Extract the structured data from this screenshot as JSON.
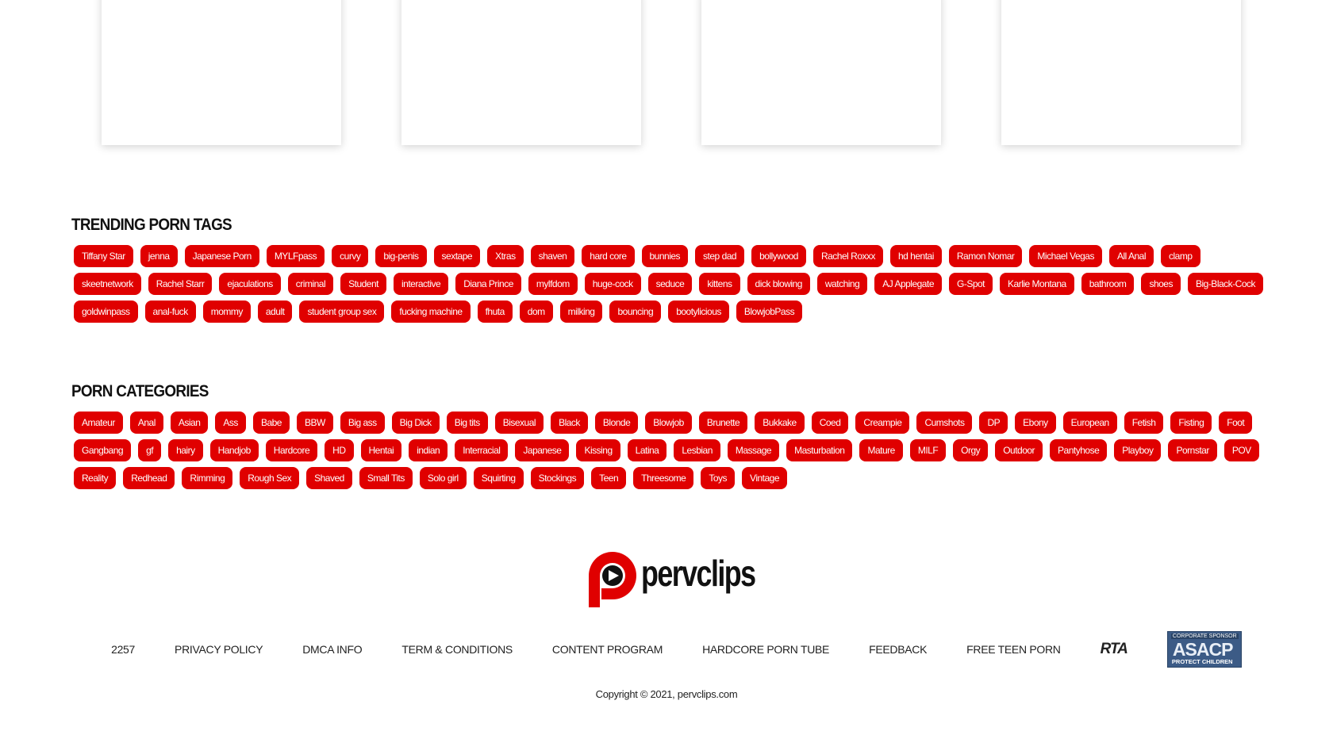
{
  "trending": {
    "heading": "TRENDING PORN TAGS",
    "tags": [
      "Tiffany Star",
      "jenna",
      "Japanese Porn",
      "MYLFpass",
      "curvy",
      "big-penis",
      "sextape",
      "Xtras",
      "shaven",
      "hard core",
      "bunnies",
      "step dad",
      "bollywood",
      "Rachel Roxxx",
      "hd hentai",
      "Ramon Nomar",
      "Michael Vegas",
      "All Anal",
      "clamp",
      "skeetnetwork",
      "Rachel Starr",
      "ejaculations",
      "criminal",
      "Student",
      "interactive",
      "Diana Prince",
      "mylfdom",
      "huge-cock",
      "seduce",
      "kittens",
      "dick blowing",
      "watching",
      "AJ Applegate",
      "G-Spot",
      "Karlie Montana",
      "bathroom",
      "shoes",
      "Big-Black-Cock",
      "goldwinpass",
      "anal-fuck",
      "mommy",
      "adult",
      "student group sex",
      "fucking machine",
      "fhuta",
      "dom",
      "milking",
      "bouncing",
      "bootylicious",
      "BlowjobPass"
    ]
  },
  "categories": {
    "heading": "PORN CATEGORIES",
    "tags": [
      "Amateur",
      "Anal",
      "Asian",
      "Ass",
      "Babe",
      "BBW",
      "Big ass",
      "Big Dick",
      "Big tits",
      "Bisexual",
      "Black",
      "Blonde",
      "Blowjob",
      "Brunette",
      "Bukkake",
      "Coed",
      "Creampie",
      "Cumshots",
      "DP",
      "Ebony",
      "European",
      "Fetish",
      "Fisting",
      "Foot",
      "Gangbang",
      "gf",
      "hairy",
      "Handjob",
      "Hardcore",
      "HD",
      "Hentai",
      "indian",
      "Interracial",
      "Japanese",
      "Kissing",
      "Latina",
      "Lesbian",
      "Massage",
      "Masturbation",
      "Mature",
      "MILF",
      "Orgy",
      "Outdoor",
      "Pantyhose",
      "Playboy",
      "Pornstar",
      "POV",
      "Reality",
      "Redhead",
      "Rimming",
      "Rough Sex",
      "Shaved",
      "Small Tits",
      "Solo girl",
      "Squirting",
      "Stockings",
      "Teen",
      "Threesome",
      "Toys",
      "Vintage"
    ]
  },
  "logo": {
    "text": "pervclips",
    "accent": "#e00000"
  },
  "footer": {
    "links": [
      "2257",
      "PRIVACY POLICY",
      "DMCA INFO",
      "TERM & CONDITIONS",
      "CONTENT PROGRAM",
      "HARDCORE PORN TUBE",
      "FEEDBACK",
      "FREE TEEN PORN"
    ],
    "rta": "RTA",
    "asacp_top": "CORPORATE SPONSOR",
    "asacp_mid": "ASACP",
    "asacp_bot": "PROTECT CHILDREN",
    "copyright": "Copyright © 2021, pervclips.com"
  },
  "colors": {
    "tag_bg": "#e00000",
    "asacp_bg": "#3c5b86"
  }
}
